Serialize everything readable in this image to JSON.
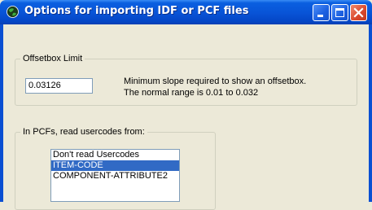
{
  "window": {
    "title": "Options for importing IDF or PCF files",
    "icon": "globe-icon",
    "controls": [
      "minimize-icon",
      "maximize-icon",
      "close-icon"
    ]
  },
  "offsetbox": {
    "legend": "Offsetbox Limit",
    "value": "0.03126",
    "hint_line1": "Minimum slope required to show an offsetbox.",
    "hint_line2": "The normal range is 0.01 to 0.032"
  },
  "usercodes": {
    "legend": "In PCFs, read usercodes from:",
    "items": [
      {
        "label": "Don't read Usercodes",
        "selected": false
      },
      {
        "label": "ITEM-CODE",
        "selected": true
      },
      {
        "label": "COMPONENT-ATTRIBUTE2",
        "selected": false
      }
    ]
  },
  "colors": {
    "title_bar": "#0853d6",
    "selection": "#316ac5",
    "close_button": "#d9472b",
    "dialog_bg": "#ece9d8"
  }
}
